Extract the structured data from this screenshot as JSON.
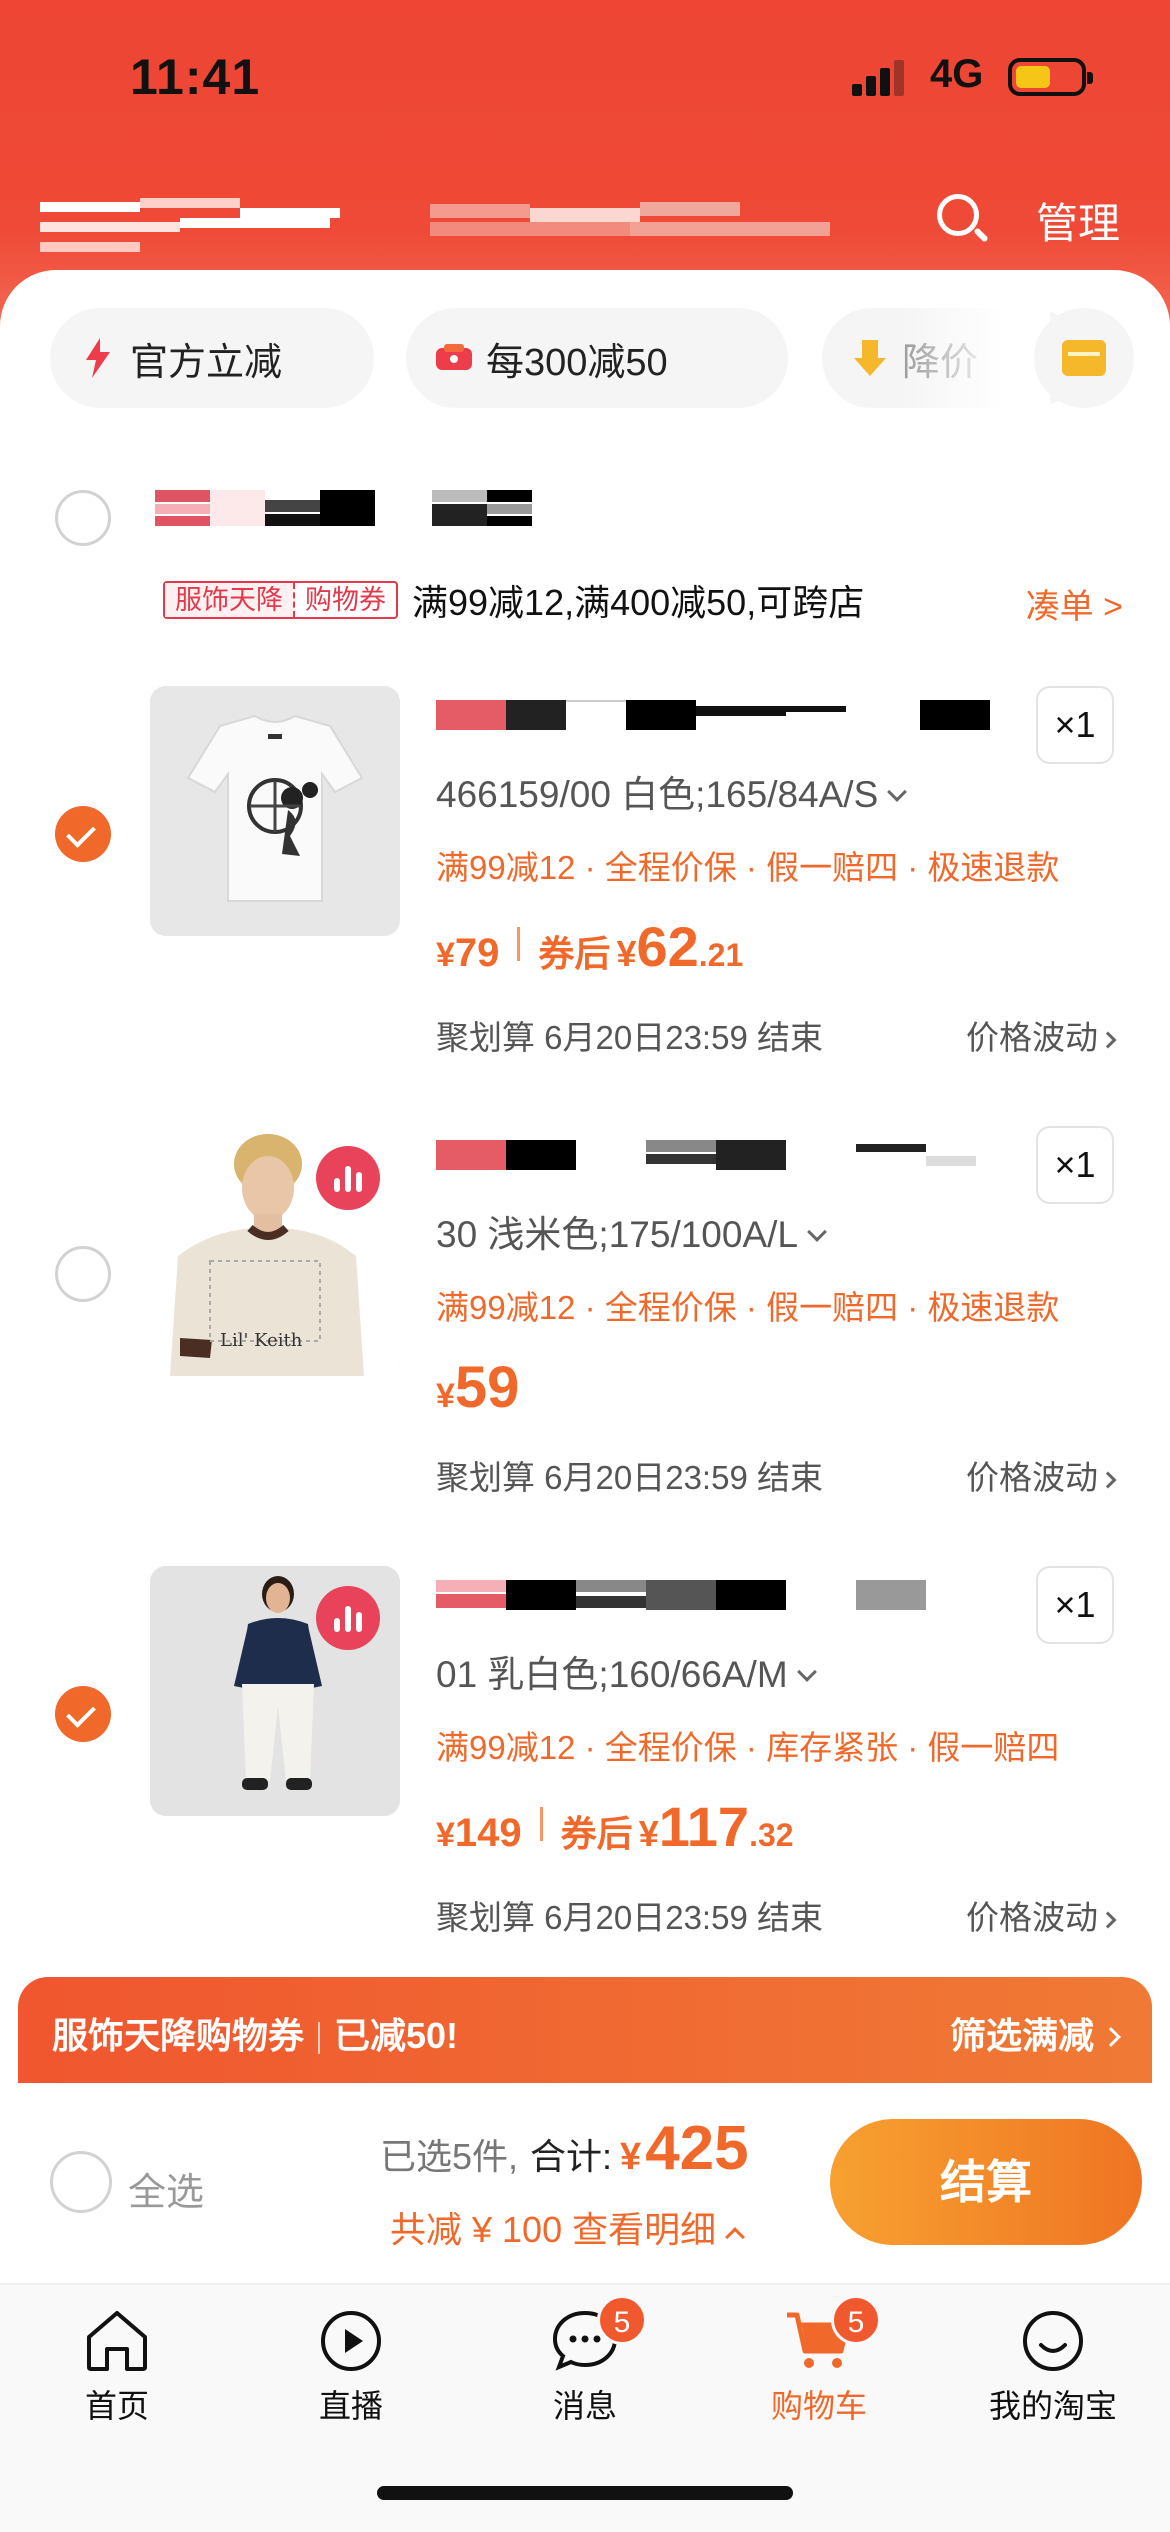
{
  "status_bar": {
    "time": "11:41",
    "network": "4G"
  },
  "header": {
    "manage_label": "管理"
  },
  "filter_chips": [
    {
      "label": "官方立减",
      "icon": "lightning-icon"
    },
    {
      "label": "每300减50",
      "icon": "coupon-icon"
    },
    {
      "label": "降价",
      "icon": "price-drop-icon"
    }
  ],
  "shop": {
    "promo_badge_left": "服饰天降",
    "promo_badge_right": "购物券",
    "promo_text": "满99减12,满400减50,可跨店",
    "combine_label": "凑单 >"
  },
  "items": [
    {
      "checked": true,
      "quantity": "×1",
      "sku": "466159/00 白色;165/84A/S",
      "tags": "满99减12 · 全程价保 · 假一赔四 · 极速退款",
      "price_currency": "¥",
      "price": "79",
      "coupon_label": "券后",
      "after_currency": "¥",
      "after_int": "62",
      "after_dec": ".21",
      "deadline": "聚划算 6月20日23:59 结束",
      "fluctuation": "价格波动"
    },
    {
      "checked": false,
      "quantity": "×1",
      "sku": "30 浅米色;175/100A/L",
      "tags": "满99减12 · 全程价保 · 假一赔四 · 极速退款",
      "price_currency": "¥",
      "price": "59",
      "deadline": "聚划算 6月20日23:59 结束",
      "fluctuation": "价格波动"
    },
    {
      "checked": true,
      "quantity": "×1",
      "sku": "01 乳白色;160/66A/M",
      "tags": "满99减12 · 全程价保 · 库存紧张 · 假一赔四",
      "price_currency": "¥",
      "price": "149",
      "coupon_label": "券后",
      "after_currency": "¥",
      "after_int": "117",
      "after_dec": ".32",
      "deadline": "聚划算 6月20日23:59 结束",
      "fluctuation": "价格波动"
    }
  ],
  "coupon_bar": {
    "left_a": "服饰天降购物券",
    "left_b": "已减50!",
    "right": "筛选满减"
  },
  "checkout": {
    "select_all": "全选",
    "selected_count": "已选5件,",
    "total_label": "合计:",
    "total_currency": "¥",
    "total_amount": "425",
    "saved_text": "共减 ¥ 100  查看明细",
    "button_label": "结算"
  },
  "tabbar": [
    {
      "label": "首页",
      "icon": "home-icon"
    },
    {
      "label": "直播",
      "icon": "live-play-icon"
    },
    {
      "label": "消息",
      "icon": "message-icon",
      "badge": "5"
    },
    {
      "label": "购物车",
      "icon": "cart-icon",
      "badge": "5",
      "active": true
    },
    {
      "label": "我的淘宝",
      "icon": "profile-icon"
    }
  ],
  "colors": {
    "header_red": "#ee4534",
    "accent_orange": "#f0692b",
    "promo_red": "#e4394b"
  }
}
